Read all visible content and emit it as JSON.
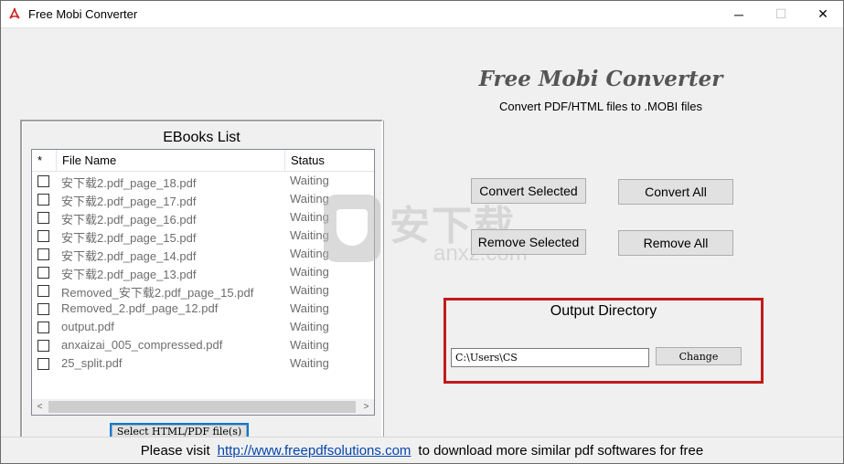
{
  "window": {
    "title": "Free Mobi Converter",
    "minimize": "─",
    "maximize": "☐",
    "close": "✕"
  },
  "ebooks": {
    "group_title": "EBooks List",
    "columns": [
      "*",
      "File Name",
      "Status"
    ],
    "rows": [
      {
        "name": "安下载2.pdf_page_18.pdf",
        "status": "Waiting"
      },
      {
        "name": "安下载2.pdf_page_17.pdf",
        "status": "Waiting"
      },
      {
        "name": "安下载2.pdf_page_16.pdf",
        "status": "Waiting"
      },
      {
        "name": "安下载2.pdf_page_15.pdf",
        "status": "Waiting"
      },
      {
        "name": "安下载2.pdf_page_14.pdf",
        "status": "Waiting"
      },
      {
        "name": "安下载2.pdf_page_13.pdf",
        "status": "Waiting"
      },
      {
        "name": "Removed_安下载2.pdf_page_15.pdf",
        "status": "Waiting"
      },
      {
        "name": "Removed_2.pdf_page_12.pdf",
        "status": "Waiting"
      },
      {
        "name": "output.pdf",
        "status": "Waiting"
      },
      {
        "name": "anxaizai_005_compressed.pdf",
        "status": "Waiting"
      },
      {
        "name": "25_split.pdf",
        "status": "Waiting"
      }
    ],
    "scroll_left": "<",
    "scroll_right": ">",
    "select_button": "Select HTML/PDF file(s)"
  },
  "header": {
    "title": "Free Mobi Converter",
    "subtitle": "Convert PDF/HTML files to .MOBI files"
  },
  "actions": {
    "convert_selected": "Convert Selected",
    "convert_all": "Convert All",
    "remove_selected": "Remove Selected",
    "remove_all": "Remove All"
  },
  "watermark": {
    "cn": "安下载",
    "en": "anxz.com"
  },
  "output": {
    "title": "Output Directory",
    "path": "C:\\Users\\CS",
    "change_button": "Change"
  },
  "footer": {
    "prefix": "Please visit",
    "link": "http://www.freepdfsolutions.com",
    "suffix": "to download more similar pdf softwares for free"
  },
  "colors": {
    "accent": "#0078d7",
    "highlight_border": "#c21b1b",
    "link": "#0645ad"
  }
}
